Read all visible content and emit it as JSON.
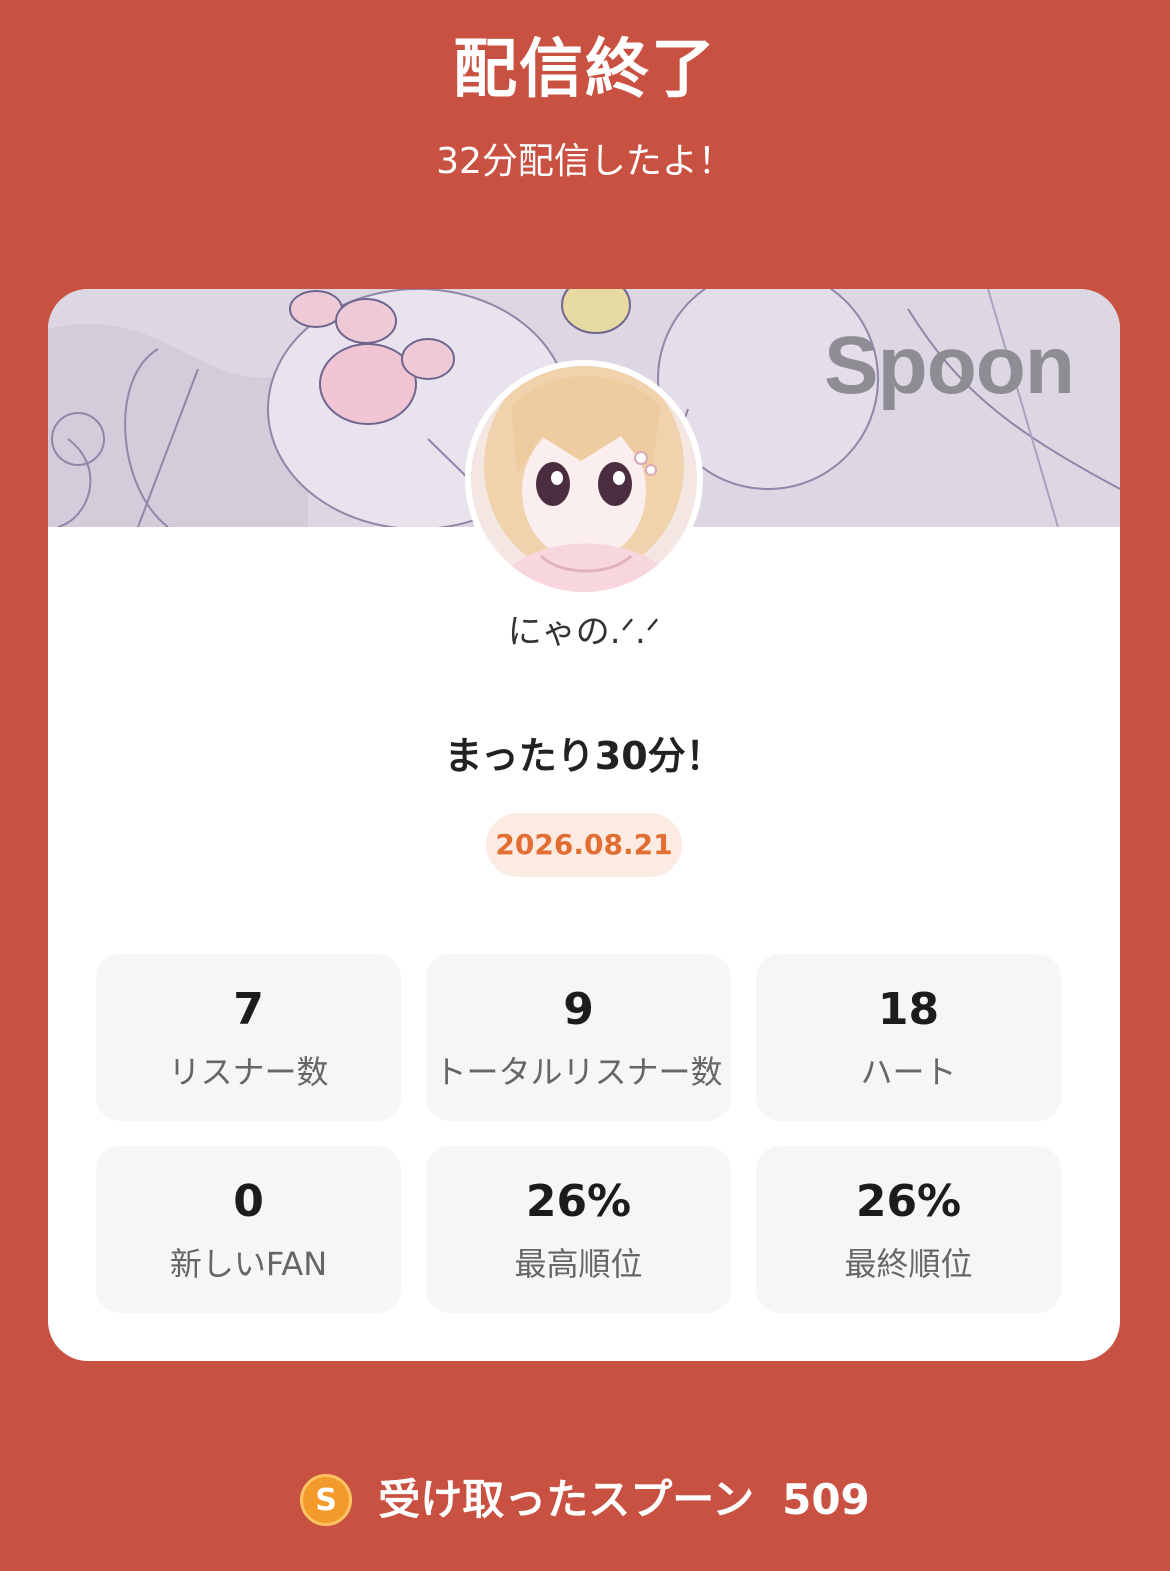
{
  "header": {
    "title": "配信終了",
    "subtitle": "32分配信したよ！"
  },
  "card": {
    "brand": "Spoon",
    "username": "にゃの.ᐟ.ᐟ",
    "broadcast_title": "まったり30分！",
    "date": "2026.08.21",
    "stats": [
      {
        "value": "7",
        "label": "リスナー数"
      },
      {
        "value": "9",
        "label": "トータルリスナー数"
      },
      {
        "value": "18",
        "label": "ハート"
      },
      {
        "value": "0",
        "label": "新しいFAN"
      },
      {
        "value": "26%",
        "label": "最高順位"
      },
      {
        "value": "26%",
        "label": "最終順位"
      }
    ]
  },
  "footer": {
    "coin_letter": "S",
    "label": "受け取ったスプーン",
    "value": "509"
  },
  "colors": {
    "background": "#c95141",
    "date_text": "#e36e33",
    "date_bg": "#fcebe3",
    "coin": "#f29a2a"
  }
}
